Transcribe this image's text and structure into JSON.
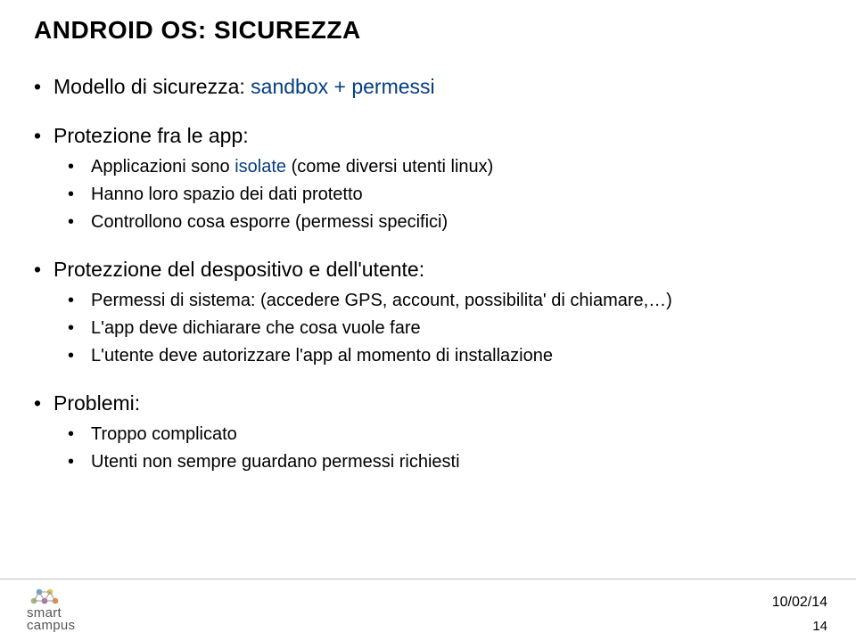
{
  "title": "ANDROID OS: SICUREZZA",
  "bullets": {
    "b1": "Modello di sicurezza: ",
    "b1_em": "sandbox + permessi",
    "b2": "Protezione fra le app:",
    "b2_1_a": "Applicazioni sono ",
    "b2_1_b": "isolate",
    "b2_1_c": " (come diversi utenti linux)",
    "b2_2": "Hanno loro spazio dei dati protetto",
    "b2_3": "Controllono cosa esporre (permessi specifici)",
    "b3": "Protezzione del despositivo e dell'utente:",
    "b3_1": "Permessi di sistema: (accedere GPS, account, possibilita' di chiamare,…)",
    "b3_2": "L'app deve dichiarare che cosa vuole fare",
    "b3_3": "L'utente deve autorizzare l'app al momento di installazione",
    "b4": "Problemi:",
    "b4_1": "Troppo complicato",
    "b4_2": "Utenti non sempre guardano permessi richiesti"
  },
  "footer": {
    "logo_line1": "smart",
    "logo_line2": "campus",
    "date": "10/02/14",
    "page": "14"
  }
}
